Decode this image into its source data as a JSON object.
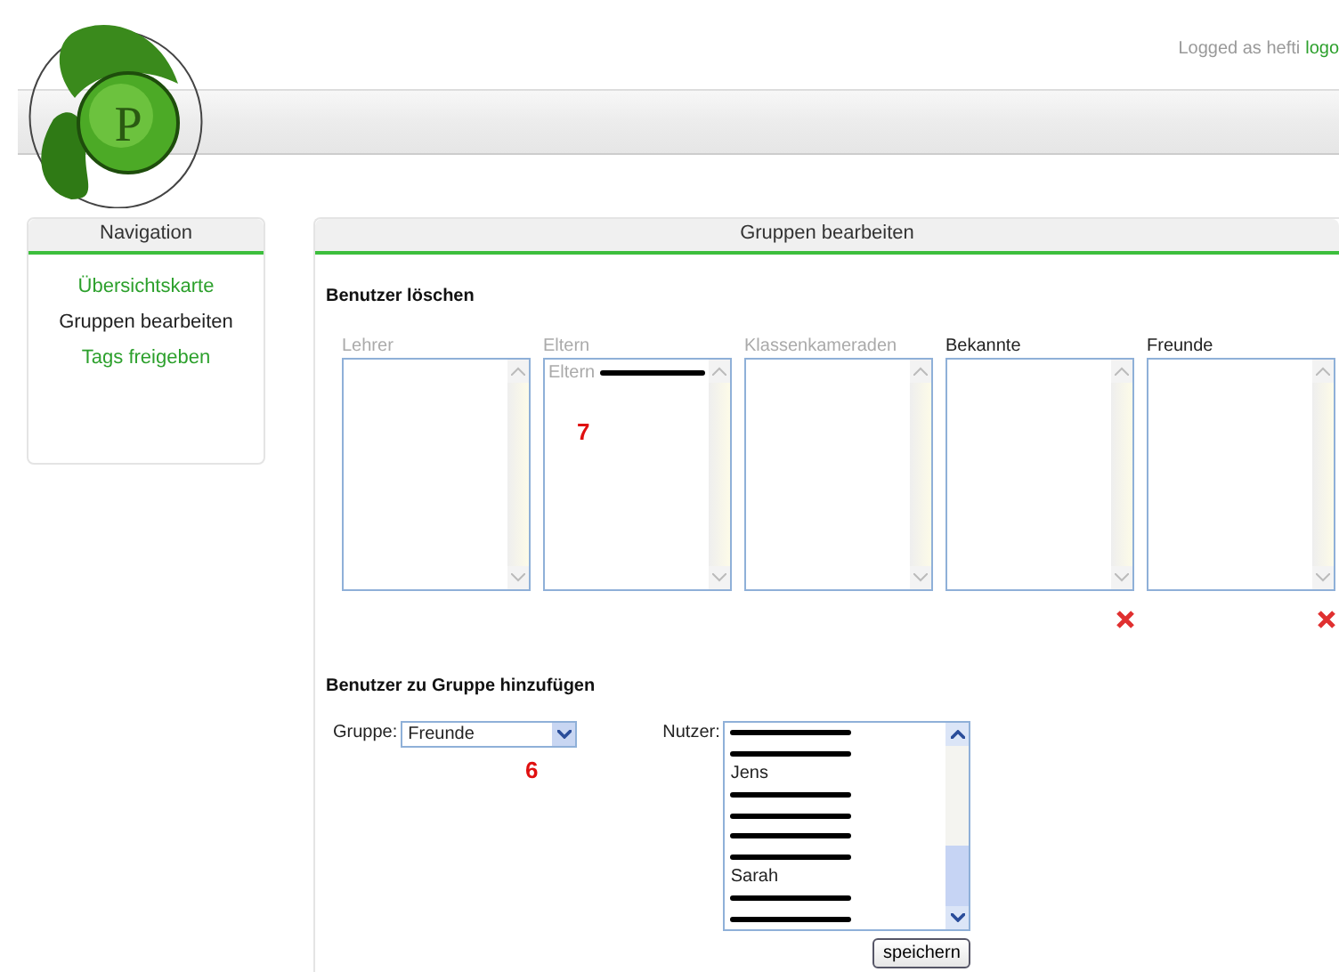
{
  "logo": {
    "letter": "P"
  },
  "login": {
    "text": "Logged as hefti",
    "link": "logo"
  },
  "navigation": {
    "title": "Navigation",
    "items": [
      {
        "label": "Übersichtskarte",
        "selected": false
      },
      {
        "label": "Gruppen bearbeiten",
        "selected": true
      },
      {
        "label": "Tags freigeben",
        "selected": false
      }
    ]
  },
  "main": {
    "title": "Gruppen bearbeiten",
    "delete_section": {
      "heading": "Benutzer löschen",
      "groups": [
        {
          "label": "Lehrer",
          "disabled": true,
          "deletable": false
        },
        {
          "label": "Eltern",
          "disabled": true,
          "deletable": false,
          "members": [
            {
              "text": "Eltern",
              "redacted": true
            }
          ]
        },
        {
          "label": "Klassenkameraden",
          "disabled": true,
          "deletable": false
        },
        {
          "label": "Bekannte",
          "disabled": false,
          "deletable": true
        },
        {
          "label": "Freunde",
          "disabled": false,
          "deletable": true
        }
      ]
    },
    "add_section": {
      "heading": "Benutzer zu Gruppe hinzufügen",
      "group_label": "Gruppe:",
      "group_value": "Freunde",
      "users_label": "Nutzer:",
      "users": [
        {
          "kind": "redacted"
        },
        {
          "kind": "redacted"
        },
        {
          "kind": "name",
          "text": "Jens"
        },
        {
          "kind": "redacted"
        },
        {
          "kind": "redacted"
        },
        {
          "kind": "redacted"
        },
        {
          "kind": "redacted"
        },
        {
          "kind": "name",
          "text": "Sarah"
        },
        {
          "kind": "redacted"
        },
        {
          "kind": "redacted"
        }
      ],
      "save_button": "speichern"
    },
    "annotations": [
      {
        "text": "7"
      },
      {
        "text": "6"
      }
    ]
  }
}
